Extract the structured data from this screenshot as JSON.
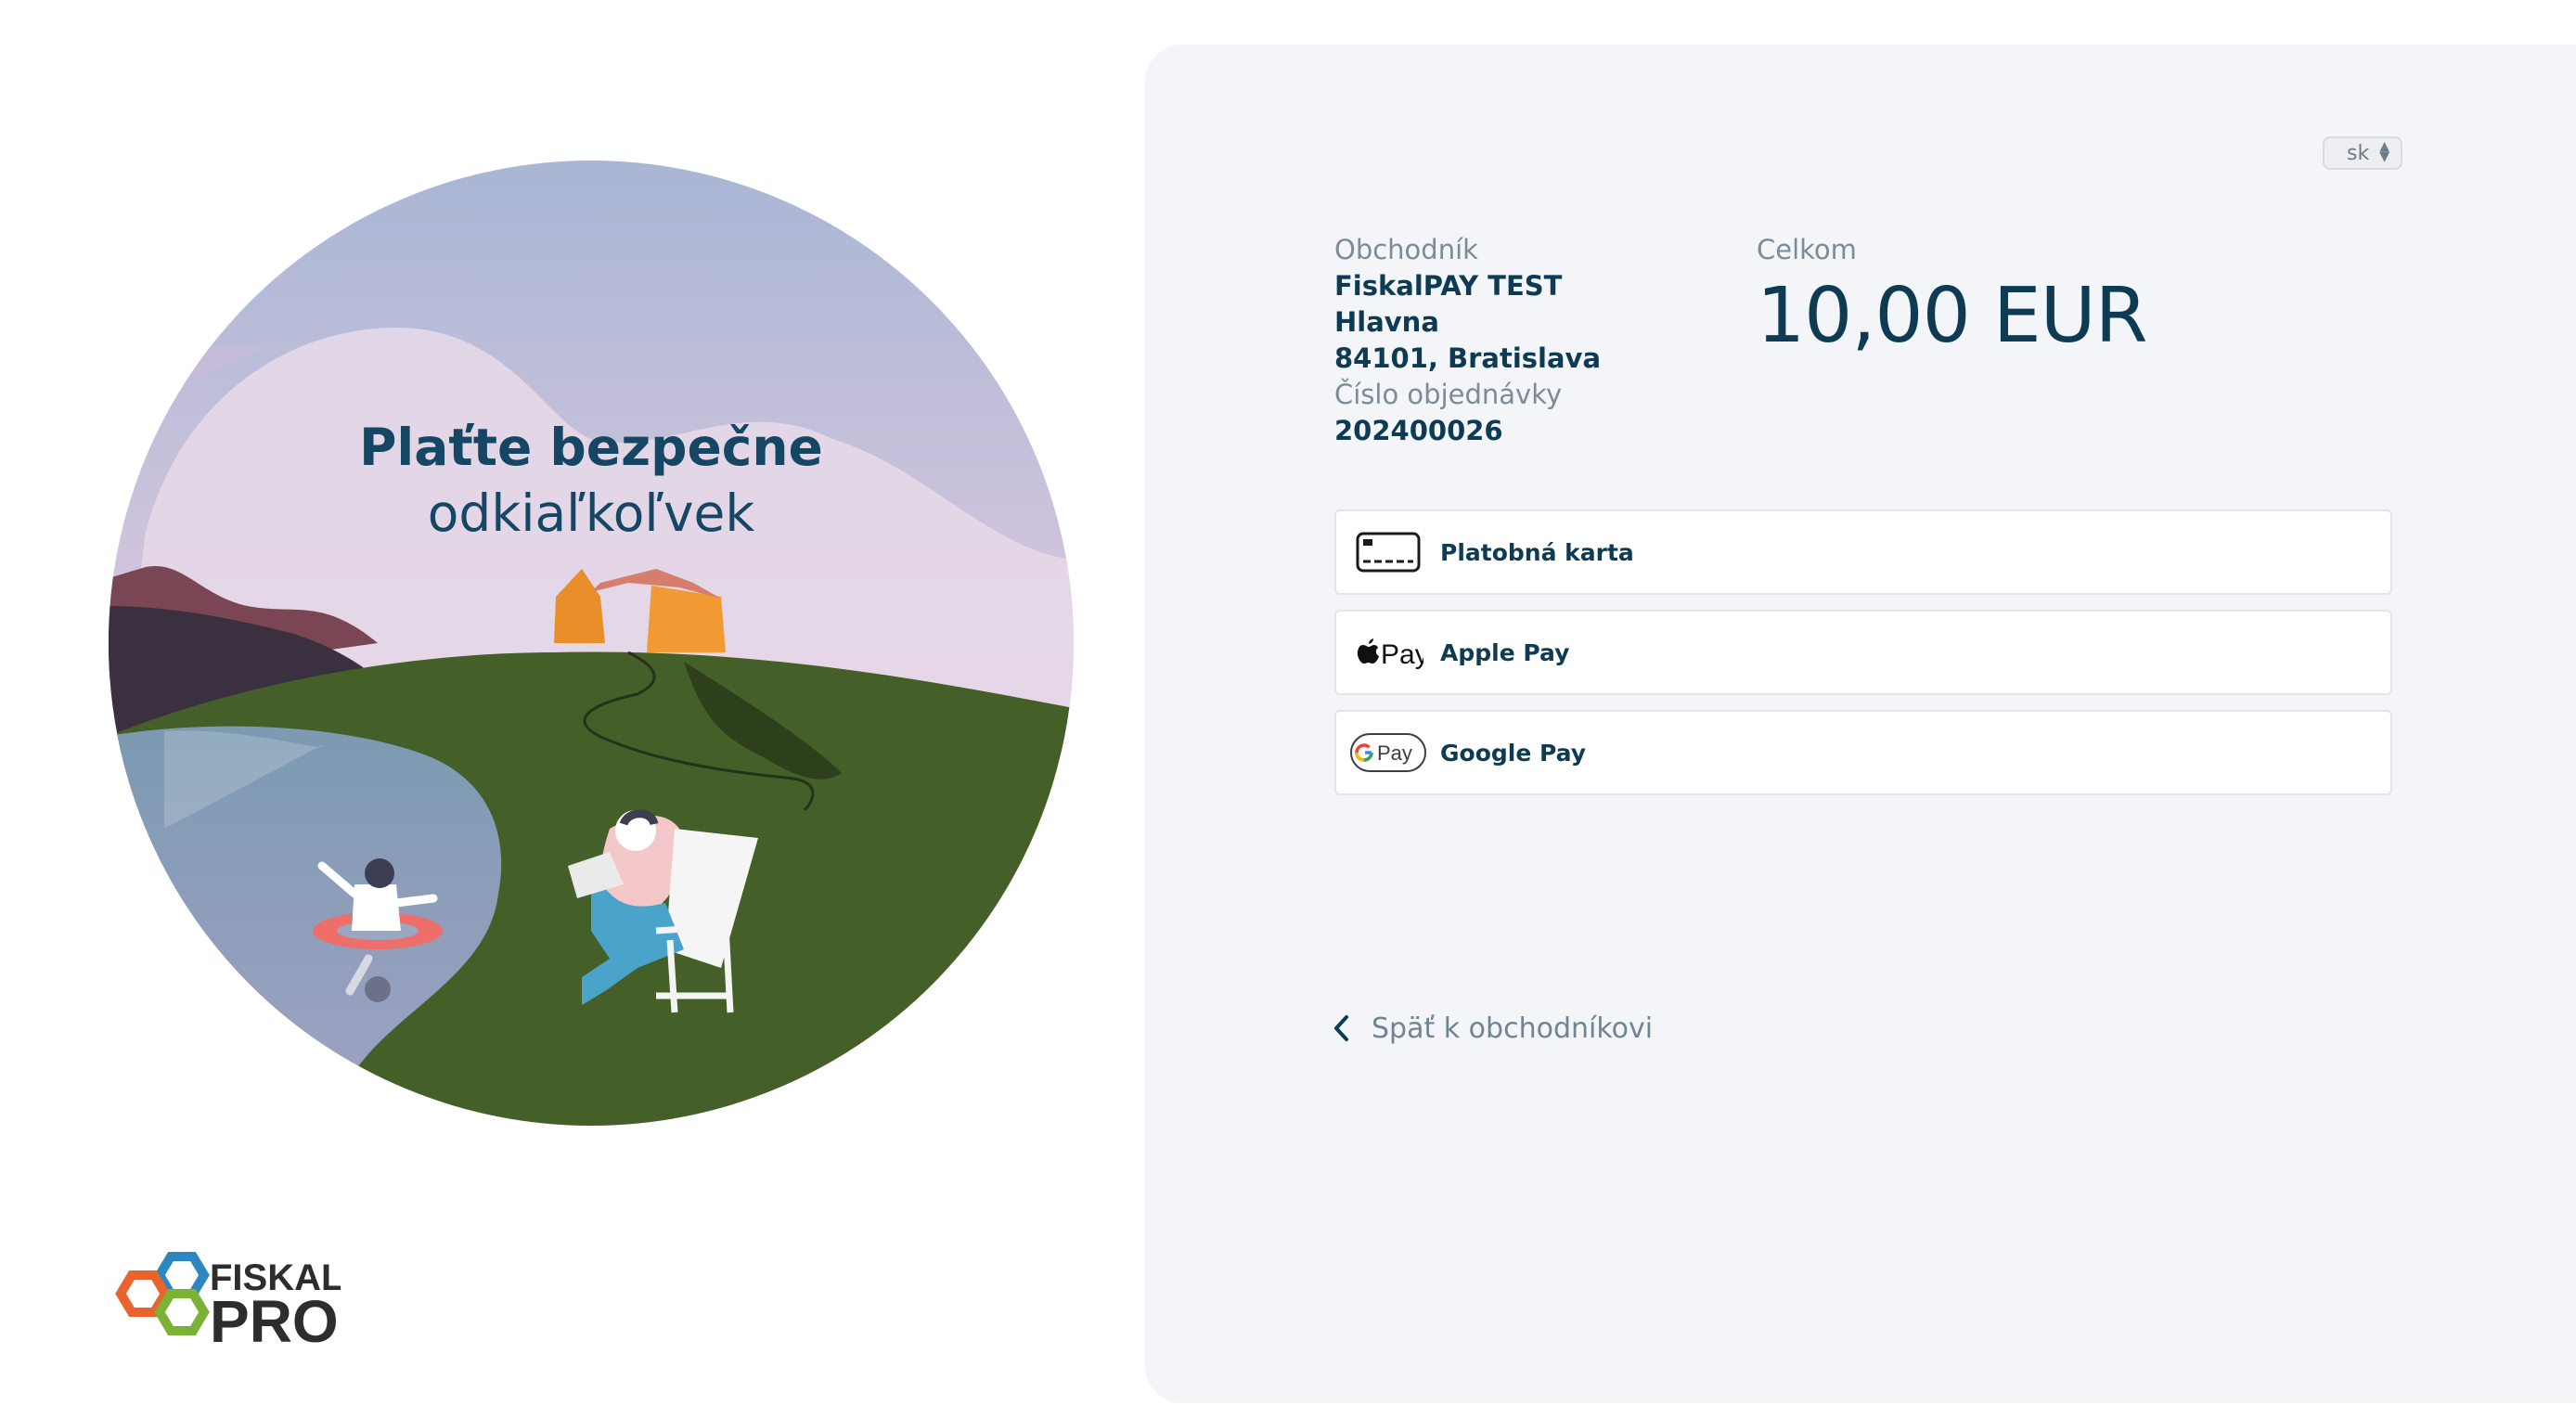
{
  "hero": {
    "title_line1": "Plaťte bezpečne",
    "title_line2": "odkiaľkoľvek"
  },
  "brand": {
    "logo_top": "FISKAL",
    "logo_bottom": "PRO"
  },
  "language": {
    "selected": "sk"
  },
  "merchant": {
    "label": "Obchodník",
    "name": "FiskalPAY TEST",
    "street": "Hlavna",
    "city": "84101, Bratislava",
    "order_label": "Číslo objednávky",
    "order_number": "202400026"
  },
  "total": {
    "label": "Celkom",
    "amount": "10,00 EUR"
  },
  "payment_methods": [
    {
      "label": "Platobná karta",
      "icon": "credit-card-icon"
    },
    {
      "label": "Apple Pay",
      "icon": "apple-pay-icon",
      "icon_text": "Pay"
    },
    {
      "label": "Google Pay",
      "icon": "google-pay-icon",
      "icon_text": "Pay"
    }
  ],
  "back_link": {
    "label": "Späť k obchodníkovi"
  },
  "colors": {
    "primary_text": "#0d3b54",
    "muted_text": "#7b8b98",
    "panel_bg": "#f3f5f9",
    "grass": "#445f27",
    "logo_blue": "#2e86c1",
    "logo_orange": "#e8642c",
    "logo_green": "#7bb135"
  }
}
